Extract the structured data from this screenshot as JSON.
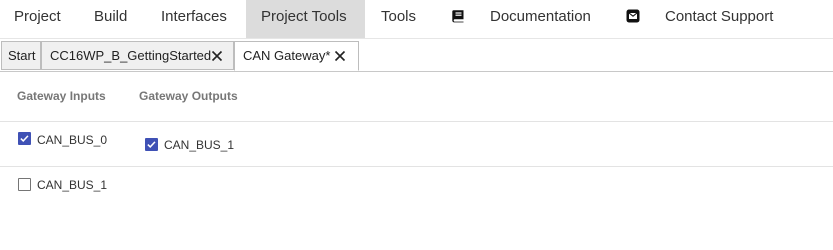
{
  "menubar": {
    "items": [
      {
        "label": "Project"
      },
      {
        "label": "Build"
      },
      {
        "label": "Interfaces"
      },
      {
        "label": "Project Tools",
        "active": true
      },
      {
        "label": "Tools"
      },
      {
        "label": "Documentation",
        "icon": "book-icon"
      },
      {
        "label": "Contact Support",
        "icon": "envelope-icon"
      }
    ]
  },
  "tabs": [
    {
      "label": "Start",
      "closable": false,
      "active": false
    },
    {
      "label": "CC16WP_B_GettingStarted",
      "closable": true,
      "active": false
    },
    {
      "label": "CAN Gateway*",
      "closable": true,
      "active": true
    }
  ],
  "gateway": {
    "inputs_header": "Gateway Inputs",
    "outputs_header": "Gateway Outputs",
    "inputs": [
      {
        "label": "CAN_BUS_0",
        "checked": true
      },
      {
        "label": "CAN_BUS_1",
        "checked": false
      }
    ],
    "outputs": [
      {
        "label": "CAN_BUS_1",
        "checked": true
      }
    ]
  },
  "colors": {
    "accent": "#3f51b5",
    "active_menu_bg": "#dcdcdc"
  }
}
